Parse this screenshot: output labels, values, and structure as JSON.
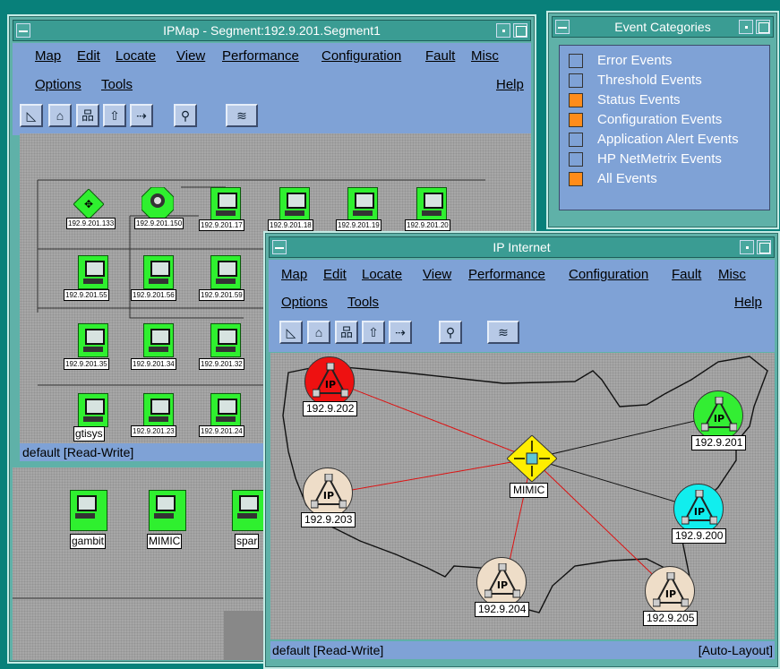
{
  "ipmap": {
    "title": "IPMap - Segment:192.9.201.Segment1",
    "menu": [
      "Map",
      "Edit",
      "Locate",
      "View",
      "Performance",
      "Configuration",
      "Fault",
      "Misc"
    ],
    "menu2": [
      "Options",
      "Tools"
    ],
    "help": "Help",
    "status": "default [Read-Write]",
    "nodes": [
      "192.9.201.133",
      "192.9.201.150",
      "192.9.201.17",
      "192.9.201.18",
      "192.9.201.19",
      "192.9.201.20",
      "192.9.201.55",
      "192.9.201.56",
      "192.9.201.59",
      "192.9.201.35",
      "192.9.201.34",
      "192.9.201.32",
      "gtisys",
      "192.9.201.23",
      "192.9.201.24"
    ],
    "lower_nodes": [
      "gambit",
      "MIMIC",
      "spar"
    ]
  },
  "events": {
    "title": "Event Categories",
    "items": [
      {
        "label": "Error Events",
        "color": "#7fa2d6"
      },
      {
        "label": "Threshold Events",
        "color": "#7fa2d6"
      },
      {
        "label": "Status Events",
        "color": "#ff8c1a"
      },
      {
        "label": "Configuration Events",
        "color": "#ff8c1a"
      },
      {
        "label": "Application Alert Events",
        "color": "#7fa2d6"
      },
      {
        "label": "HP NetMetrix Events",
        "color": "#7fa2d6"
      },
      {
        "label": "All Events",
        "color": "#ff8c1a"
      }
    ]
  },
  "internet": {
    "title": "IP Internet",
    "menu": [
      "Map",
      "Edit",
      "Locate",
      "View",
      "Performance",
      "Configuration",
      "Fault",
      "Misc"
    ],
    "menu2": [
      "Options",
      "Tools"
    ],
    "help": "Help",
    "status": "default [Read-Write]",
    "layout": "[Auto-Layout]",
    "nodes": [
      {
        "label": "192.9.202",
        "color": "#ee1111"
      },
      {
        "label": "192.9.201",
        "color": "#33ee33"
      },
      {
        "label": "192.9.203",
        "color": "#eeddc8"
      },
      {
        "label": "192.9.200",
        "color": "#11eeee"
      },
      {
        "label": "192.9.204",
        "color": "#eeddc8"
      },
      {
        "label": "192.9.205",
        "color": "#eeddc8"
      }
    ],
    "hub": "MIMIC"
  },
  "colors": {
    "critical": "#ee1111",
    "normal": "#33ee33",
    "unknown": "#eeddc8",
    "marginal": "#11eeee",
    "hub": "#ffee00"
  }
}
